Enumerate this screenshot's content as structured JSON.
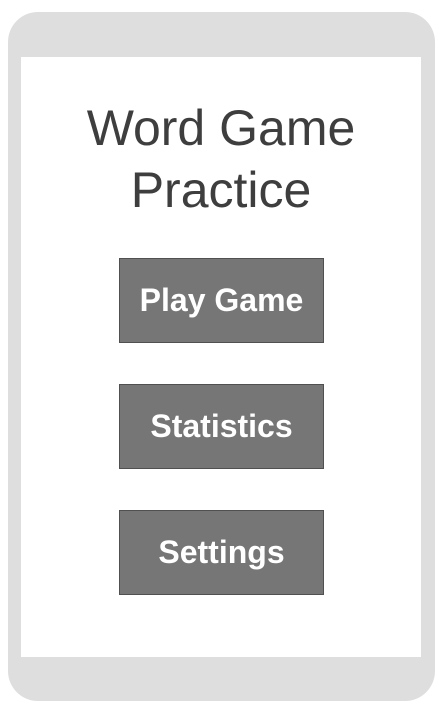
{
  "title": {
    "line1": "Word Game",
    "line2": "Practice"
  },
  "menu": {
    "play_label": "Play Game",
    "statistics_label": "Statistics",
    "settings_label": "Settings"
  },
  "colors": {
    "frame": "#dedede",
    "screen": "#ffffff",
    "button_bg": "#767676",
    "button_text": "#ffffff",
    "title_text": "#3e3e3e"
  }
}
